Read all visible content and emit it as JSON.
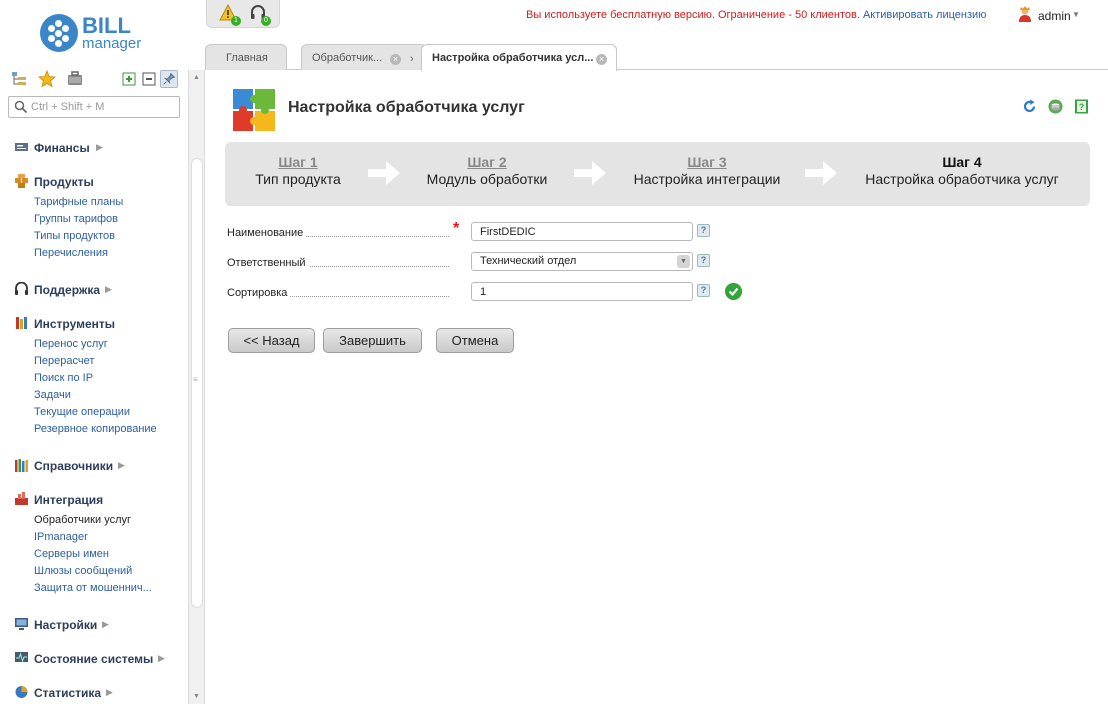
{
  "logo": {
    "bill": "BILL",
    "manager": "manager"
  },
  "notifications": {
    "warnings_count": "1",
    "support_count": "0"
  },
  "license_notice": {
    "text": "Вы используете бесплатную версию. Ограничение - 50 клиентов.",
    "link": "Активировать лицензию"
  },
  "user": {
    "name": "admin"
  },
  "tabs": [
    {
      "label": "Главная"
    },
    {
      "label": "Обработчик..."
    },
    {
      "label": "Настройка обработчика усл..."
    }
  ],
  "sidebar": {
    "search_placeholder": "Ctrl + Shift + M",
    "sections": [
      {
        "label": "Финансы",
        "items": []
      },
      {
        "label": "Продукты",
        "items": [
          "Тарифные планы",
          "Группы тарифов",
          "Типы продуктов",
          "Перечисления"
        ]
      },
      {
        "label": "Поддержка",
        "items": []
      },
      {
        "label": "Инструменты",
        "items": [
          "Перенос услуг",
          "Перерасчет",
          "Поиск по IP",
          "Задачи",
          "Текущие операции",
          "Резервное копирование"
        ]
      },
      {
        "label": "Справочники",
        "items": []
      },
      {
        "label": "Интеграция",
        "items": [
          "Обработчики услуг",
          "IPmanager",
          "Серверы имен",
          "Шлюзы сообщений",
          "Защита от мошеннич..."
        ]
      },
      {
        "label": "Настройки",
        "items": []
      },
      {
        "label": "Состояние системы",
        "items": []
      },
      {
        "label": "Статистика",
        "items": []
      }
    ]
  },
  "page": {
    "title": "Настройка обработчика услуг"
  },
  "wizard": {
    "steps": [
      {
        "num": "Шаг 1",
        "name": "Тип продукта"
      },
      {
        "num": "Шаг 2",
        "name": "Модуль обработки"
      },
      {
        "num": "Шаг 3",
        "name": "Настройка интеграции"
      },
      {
        "num": "Шаг 4",
        "name": "Настройка обработчика услуг"
      }
    ]
  },
  "form": {
    "name": {
      "label": "Наименование",
      "value": "FirstDEDIC"
    },
    "responsible": {
      "label": "Ответственный",
      "value": "Технический отдел"
    },
    "sort": {
      "label": "Сортировка",
      "value": "1"
    },
    "help_symbol": "?"
  },
  "buttons": {
    "back": "<< Назад",
    "finish": "Завершить",
    "cancel": "Отмена"
  },
  "colors": {
    "accent": "#3a86c8",
    "link": "#2c5fa0",
    "warning": "#d01a1a",
    "success": "#2fa53a"
  }
}
